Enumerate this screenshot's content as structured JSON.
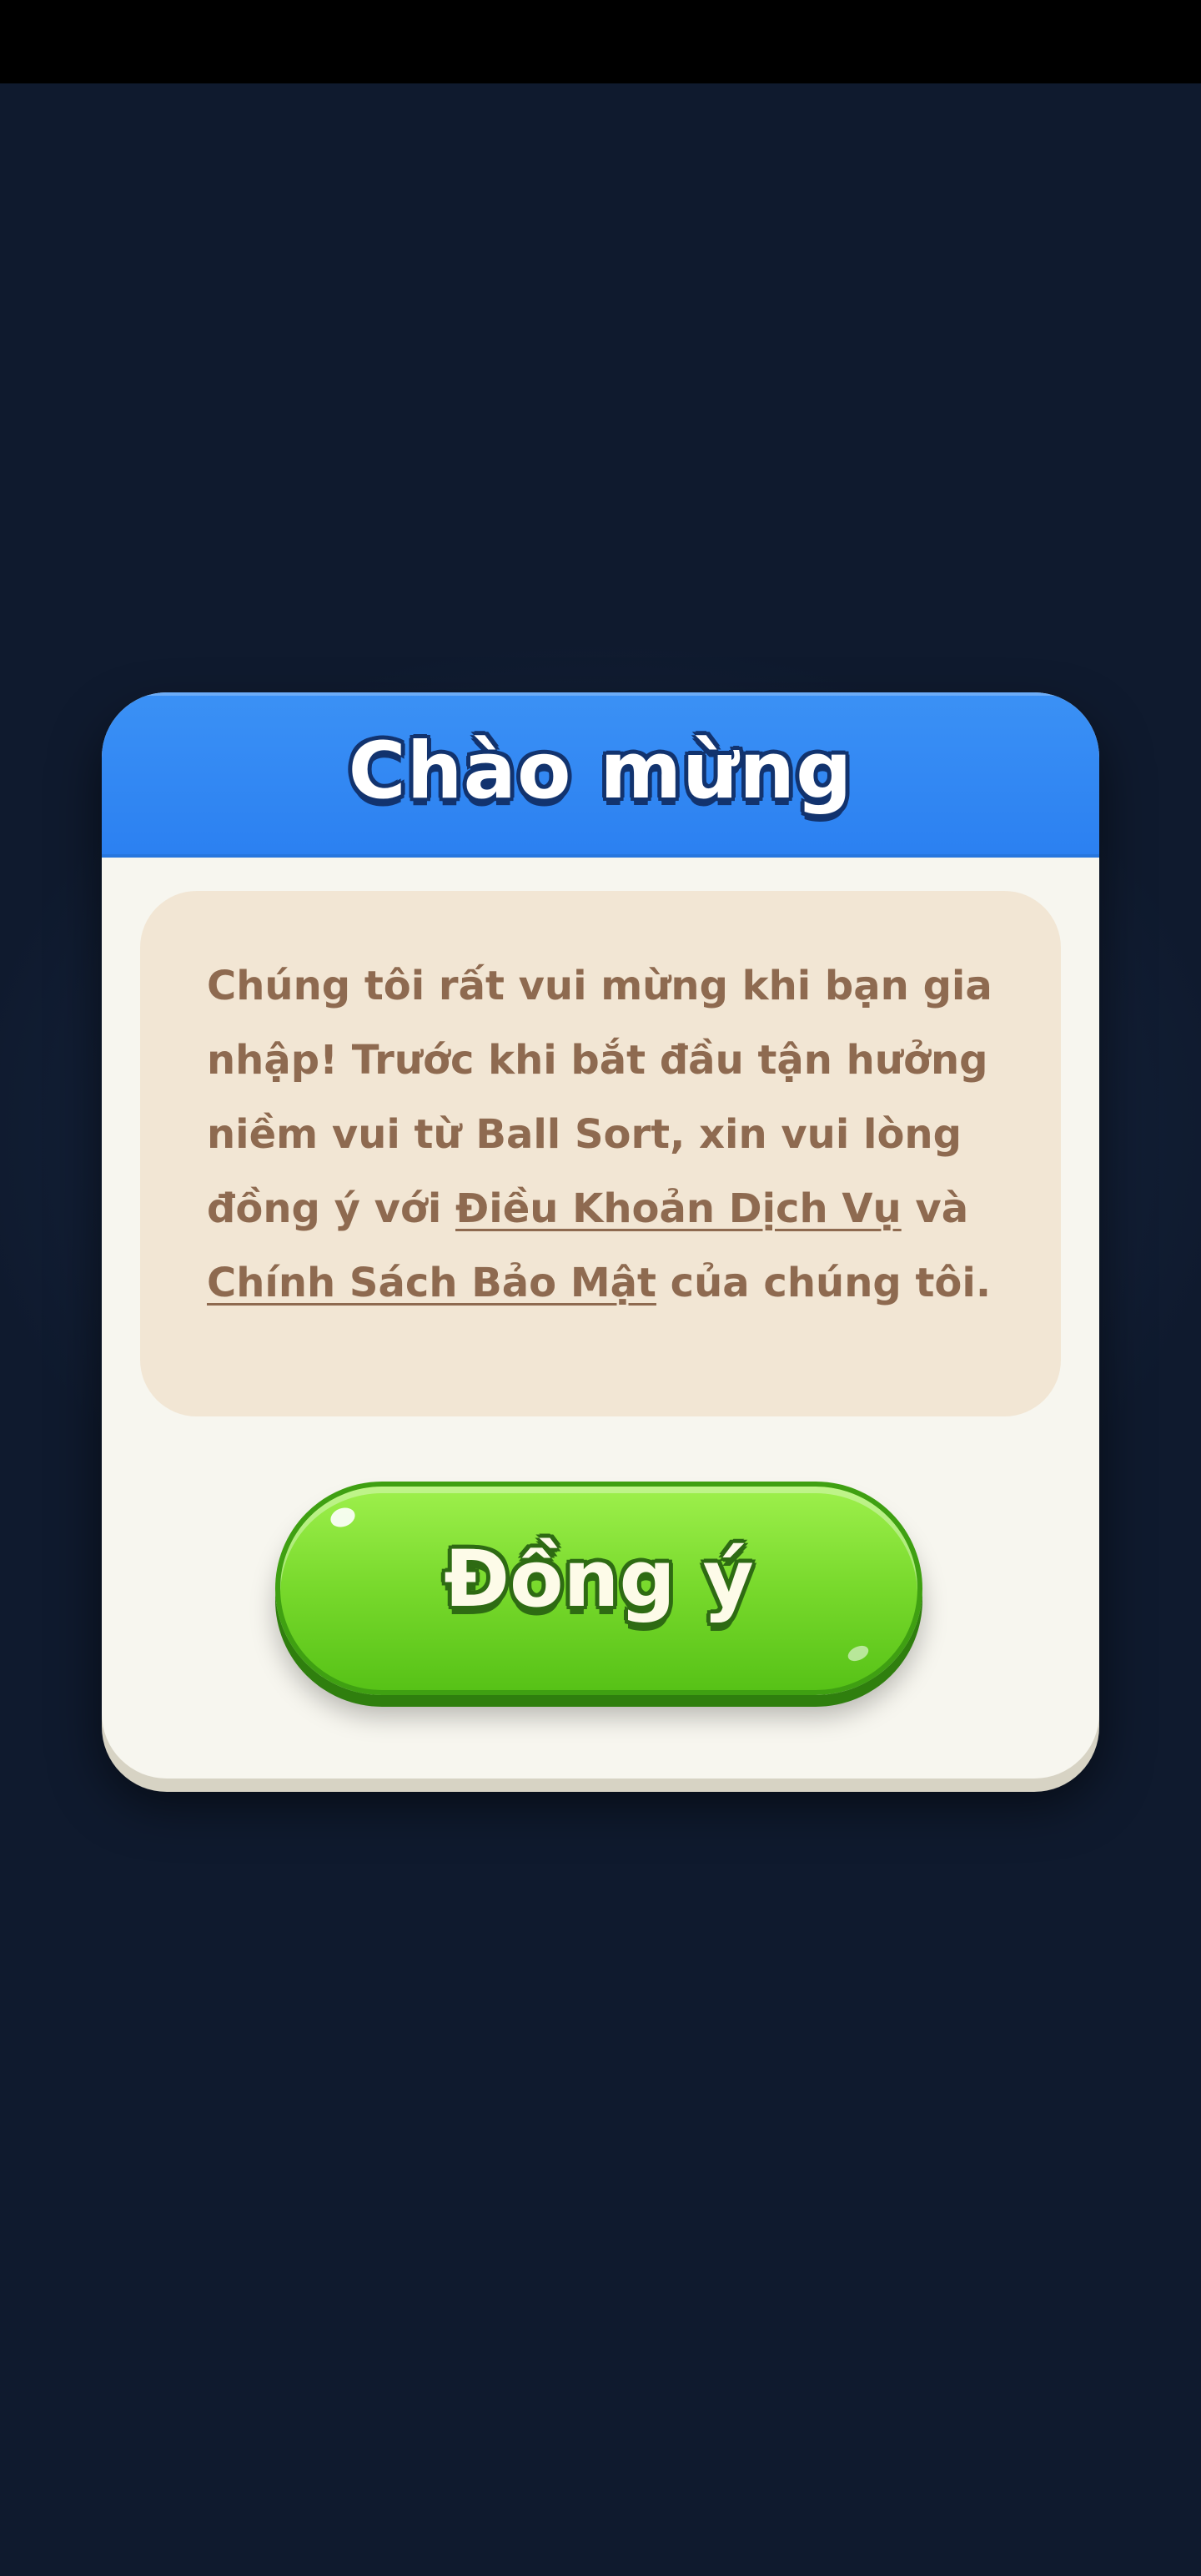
{
  "colors": {
    "header_blue": "#2b80f1",
    "message_text": "#8e6a50",
    "message_bg": "#f2e6d4",
    "dialog_bg": "#f7f6ef",
    "button_green": "#78d92c",
    "page_bg": "#0f1a2e"
  },
  "dialog": {
    "title": "Chào mừng",
    "message": {
      "text_before": "Chúng tôi rất vui mừng khi bạn gia nhập! Trước khi bắt đầu tận hưởng niềm vui từ Ball Sort, xin vui lòng đồng ý với ",
      "terms_link": "Điều Khoản Dịch Vụ",
      "text_middle": " và ",
      "privacy_link": "Chính Sách Bảo Mật",
      "text_after": " của chúng tôi."
    },
    "agree_button": "Đồng ý"
  }
}
